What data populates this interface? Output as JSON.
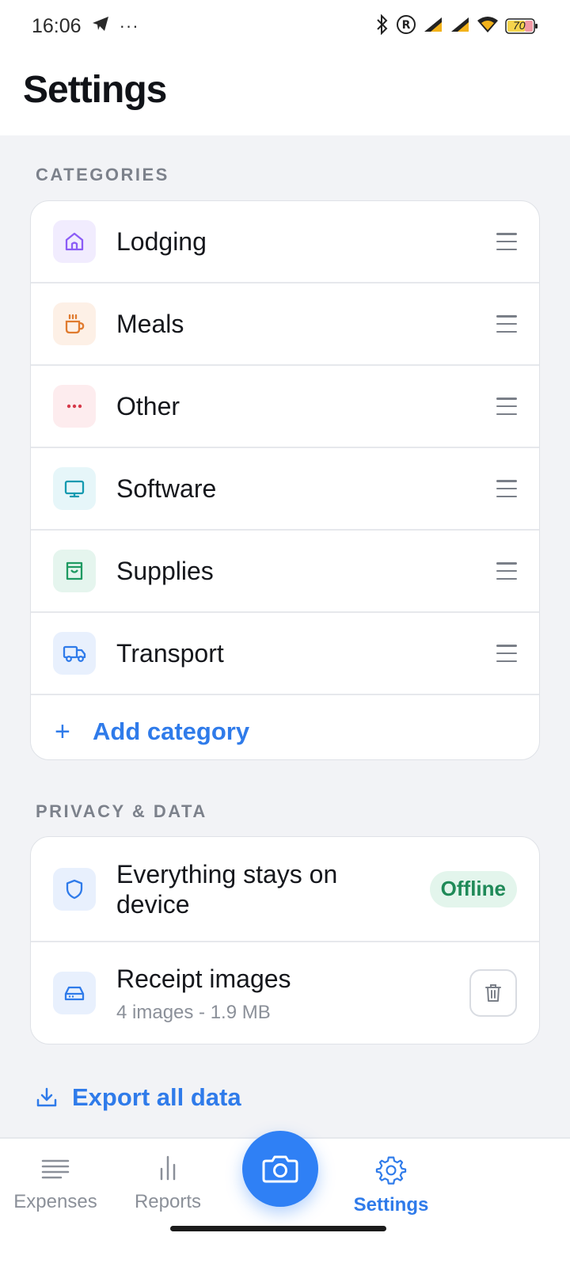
{
  "status_bar": {
    "time": "16:06",
    "battery": "70"
  },
  "header": {
    "title": "Settings"
  },
  "categories": {
    "section_label": "CATEGORIES",
    "items": [
      {
        "label": "Lodging",
        "icon": "home-icon",
        "color": "#8b5cf6",
        "bg": "#f1ecfe"
      },
      {
        "label": "Meals",
        "icon": "coffee-cup-icon",
        "color": "#e07b2f",
        "bg": "#fdf0e6"
      },
      {
        "label": "Other",
        "icon": "dots-icon",
        "color": "#d6394a",
        "bg": "#fdecee"
      },
      {
        "label": "Software",
        "icon": "monitor-icon",
        "color": "#139ab0",
        "bg": "#e6f6f9"
      },
      {
        "label": "Supplies",
        "icon": "shopping-bag-icon",
        "color": "#1f9a62",
        "bg": "#e5f5ee"
      },
      {
        "label": "Transport",
        "icon": "truck-icon",
        "color": "#2f7bea",
        "bg": "#e8f0fd"
      }
    ],
    "add_label": "Add category",
    "add_symbol": "+"
  },
  "privacy": {
    "section_label": "PRIVACY & DATA",
    "device_label": "Everything stays on device",
    "device_badge": "Offline",
    "receipts_label": "Receipt images",
    "receipts_meta": "4 images - 1.9 MB"
  },
  "export_label": "Export all data",
  "nav": {
    "expenses": "Expenses",
    "reports": "Reports",
    "settings": "Settings"
  },
  "colors": {
    "accent": "#2f7bea",
    "offline_badge_bg": "#e3f5ec",
    "offline_badge_text": "#1f8a58"
  }
}
